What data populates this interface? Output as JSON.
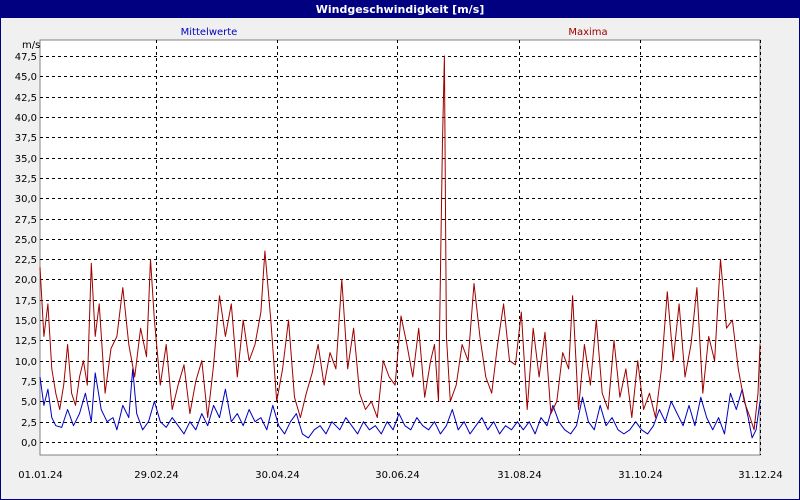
{
  "window": {
    "title": "Windgeschwindigkeit [m/s]"
  },
  "chart_data": {
    "type": "line",
    "title": "Windgeschwindigkeit [m/s]",
    "ylabel": "m/s",
    "xlabel": "",
    "ylim": [
      0,
      47.5
    ],
    "xlim": [
      "2024-01-01",
      "2024-12-31"
    ],
    "y_ticks": [
      "0,0",
      "2,5",
      "5,0",
      "7,5",
      "10,0",
      "12,5",
      "15,0",
      "17,5",
      "20,0",
      "22,5",
      "25,0",
      "27,5",
      "30,0",
      "32,5",
      "35,0",
      "37,5",
      "40,0",
      "42,5",
      "45,0",
      "47,5"
    ],
    "x_ticks": [
      {
        "date": "2024-01-01",
        "label": "01.01.24"
      },
      {
        "date": "2024-02-29",
        "label": "29.02.24"
      },
      {
        "date": "2024-04-30",
        "label": "30.04.24"
      },
      {
        "date": "2024-06-30",
        "label": "30.06.24"
      },
      {
        "date": "2024-08-31",
        "label": "31.08.24"
      },
      {
        "date": "2024-10-31",
        "label": "31.10.24"
      },
      {
        "date": "2024-12-31",
        "label": "31.12.24"
      }
    ],
    "grid": true,
    "series": [
      {
        "name": "Mittelwerte",
        "color": "#0000c0",
        "points": [
          [
            "2024-01-01",
            8.0
          ],
          [
            "2024-01-03",
            4.5
          ],
          [
            "2024-01-05",
            6.5
          ],
          [
            "2024-01-07",
            3.0
          ],
          [
            "2024-01-09",
            2.0
          ],
          [
            "2024-01-12",
            1.8
          ],
          [
            "2024-01-15",
            4.0
          ],
          [
            "2024-01-18",
            2.0
          ],
          [
            "2024-01-21",
            3.5
          ],
          [
            "2024-01-24",
            6.0
          ],
          [
            "2024-01-27",
            2.5
          ],
          [
            "2024-01-29",
            8.5
          ],
          [
            "2024-02-01",
            4.0
          ],
          [
            "2024-02-04",
            2.5
          ],
          [
            "2024-02-07",
            3.0
          ],
          [
            "2024-02-09",
            1.5
          ],
          [
            "2024-02-12",
            4.5
          ],
          [
            "2024-02-15",
            3.0
          ],
          [
            "2024-02-17",
            9.0
          ],
          [
            "2024-02-19",
            3.5
          ],
          [
            "2024-02-22",
            1.5
          ],
          [
            "2024-02-25",
            2.5
          ],
          [
            "2024-02-28",
            5.0
          ],
          [
            "2024-03-02",
            2.5
          ],
          [
            "2024-03-05",
            1.8
          ],
          [
            "2024-03-08",
            3.0
          ],
          [
            "2024-03-11",
            2.0
          ],
          [
            "2024-03-14",
            1.0
          ],
          [
            "2024-03-17",
            2.5
          ],
          [
            "2024-03-20",
            1.5
          ],
          [
            "2024-03-23",
            3.5
          ],
          [
            "2024-03-26",
            2.0
          ],
          [
            "2024-03-29",
            4.5
          ],
          [
            "2024-04-01",
            3.0
          ],
          [
            "2024-04-04",
            6.5
          ],
          [
            "2024-04-07",
            2.5
          ],
          [
            "2024-04-10",
            3.5
          ],
          [
            "2024-04-13",
            2.0
          ],
          [
            "2024-04-16",
            4.0
          ],
          [
            "2024-04-19",
            2.5
          ],
          [
            "2024-04-22",
            3.0
          ],
          [
            "2024-04-25",
            1.5
          ],
          [
            "2024-04-28",
            4.5
          ],
          [
            "2024-05-01",
            2.0
          ],
          [
            "2024-05-04",
            1.0
          ],
          [
            "2024-05-07",
            2.5
          ],
          [
            "2024-05-10",
            3.5
          ],
          [
            "2024-05-13",
            1.0
          ],
          [
            "2024-05-16",
            0.5
          ],
          [
            "2024-05-19",
            1.5
          ],
          [
            "2024-05-22",
            2.0
          ],
          [
            "2024-05-25",
            1.0
          ],
          [
            "2024-05-28",
            2.5
          ],
          [
            "2024-06-01",
            1.5
          ],
          [
            "2024-06-04",
            3.0
          ],
          [
            "2024-06-07",
            2.0
          ],
          [
            "2024-06-10",
            1.0
          ],
          [
            "2024-06-13",
            2.5
          ],
          [
            "2024-06-16",
            1.5
          ],
          [
            "2024-06-19",
            2.0
          ],
          [
            "2024-06-22",
            1.0
          ],
          [
            "2024-06-25",
            2.5
          ],
          [
            "2024-06-28",
            1.5
          ],
          [
            "2024-07-01",
            3.5
          ],
          [
            "2024-07-04",
            2.0
          ],
          [
            "2024-07-07",
            1.5
          ],
          [
            "2024-07-10",
            3.0
          ],
          [
            "2024-07-13",
            2.0
          ],
          [
            "2024-07-16",
            1.5
          ],
          [
            "2024-07-19",
            2.5
          ],
          [
            "2024-07-22",
            1.0
          ],
          [
            "2024-07-25",
            2.0
          ],
          [
            "2024-07-28",
            4.0
          ],
          [
            "2024-07-31",
            1.5
          ],
          [
            "2024-08-03",
            2.5
          ],
          [
            "2024-08-06",
            1.0
          ],
          [
            "2024-08-09",
            2.0
          ],
          [
            "2024-08-12",
            3.0
          ],
          [
            "2024-08-15",
            1.5
          ],
          [
            "2024-08-18",
            2.5
          ],
          [
            "2024-08-21",
            1.0
          ],
          [
            "2024-08-24",
            2.0
          ],
          [
            "2024-08-27",
            1.5
          ],
          [
            "2024-08-30",
            2.5
          ],
          [
            "2024-09-02",
            1.5
          ],
          [
            "2024-09-05",
            2.5
          ],
          [
            "2024-09-08",
            1.0
          ],
          [
            "2024-09-11",
            3.0
          ],
          [
            "2024-09-14",
            2.0
          ],
          [
            "2024-09-17",
            4.5
          ],
          [
            "2024-09-20",
            2.5
          ],
          [
            "2024-09-23",
            1.5
          ],
          [
            "2024-09-26",
            1.0
          ],
          [
            "2024-09-29",
            2.0
          ],
          [
            "2024-10-02",
            5.5
          ],
          [
            "2024-10-05",
            2.5
          ],
          [
            "2024-10-08",
            1.5
          ],
          [
            "2024-10-11",
            4.5
          ],
          [
            "2024-10-14",
            2.0
          ],
          [
            "2024-10-17",
            3.0
          ],
          [
            "2024-10-20",
            1.5
          ],
          [
            "2024-10-23",
            1.0
          ],
          [
            "2024-10-26",
            1.5
          ],
          [
            "2024-10-29",
            2.5
          ],
          [
            "2024-11-01",
            1.5
          ],
          [
            "2024-11-04",
            1.0
          ],
          [
            "2024-11-07",
            2.0
          ],
          [
            "2024-11-10",
            4.0
          ],
          [
            "2024-11-13",
            2.5
          ],
          [
            "2024-11-16",
            5.0
          ],
          [
            "2024-11-19",
            3.5
          ],
          [
            "2024-11-22",
            2.0
          ],
          [
            "2024-11-25",
            4.5
          ],
          [
            "2024-11-28",
            2.0
          ],
          [
            "2024-12-01",
            5.5
          ],
          [
            "2024-12-04",
            3.0
          ],
          [
            "2024-12-07",
            1.5
          ],
          [
            "2024-12-10",
            3.0
          ],
          [
            "2024-12-13",
            1.0
          ],
          [
            "2024-12-16",
            6.0
          ],
          [
            "2024-12-19",
            4.0
          ],
          [
            "2024-12-22",
            6.5
          ],
          [
            "2024-12-25",
            3.0
          ],
          [
            "2024-12-27",
            0.5
          ],
          [
            "2024-12-29",
            1.5
          ],
          [
            "2024-12-31",
            5.0
          ]
        ]
      },
      {
        "name": "Maxima",
        "color": "#a00000",
        "points": [
          [
            "2024-01-01",
            21.5
          ],
          [
            "2024-01-03",
            13.0
          ],
          [
            "2024-01-05",
            17.0
          ],
          [
            "2024-01-07",
            9.0
          ],
          [
            "2024-01-09",
            6.0
          ],
          [
            "2024-01-11",
            4.0
          ],
          [
            "2024-01-13",
            7.0
          ],
          [
            "2024-01-15",
            12.0
          ],
          [
            "2024-01-17",
            6.0
          ],
          [
            "2024-01-19",
            4.5
          ],
          [
            "2024-01-21",
            8.0
          ],
          [
            "2024-01-23",
            10.0
          ],
          [
            "2024-01-25",
            7.0
          ],
          [
            "2024-01-27",
            22.0
          ],
          [
            "2024-01-29",
            13.0
          ],
          [
            "2024-01-31",
            17.0
          ],
          [
            "2024-02-03",
            6.0
          ],
          [
            "2024-02-06",
            11.5
          ],
          [
            "2024-02-09",
            13.0
          ],
          [
            "2024-02-12",
            19.0
          ],
          [
            "2024-02-15",
            12.0
          ],
          [
            "2024-02-18",
            8.0
          ],
          [
            "2024-02-21",
            14.0
          ],
          [
            "2024-02-24",
            10.5
          ],
          [
            "2024-02-26",
            22.5
          ],
          [
            "2024-02-28",
            15.0
          ],
          [
            "2024-03-02",
            7.0
          ],
          [
            "2024-03-05",
            12.0
          ],
          [
            "2024-03-08",
            4.0
          ],
          [
            "2024-03-11",
            7.0
          ],
          [
            "2024-03-14",
            9.5
          ],
          [
            "2024-03-17",
            3.5
          ],
          [
            "2024-03-20",
            7.5
          ],
          [
            "2024-03-23",
            10.0
          ],
          [
            "2024-03-26",
            3.0
          ],
          [
            "2024-03-29",
            9.5
          ],
          [
            "2024-04-01",
            18.0
          ],
          [
            "2024-04-04",
            13.0
          ],
          [
            "2024-04-07",
            17.0
          ],
          [
            "2024-04-10",
            8.0
          ],
          [
            "2024-04-13",
            15.0
          ],
          [
            "2024-04-16",
            10.0
          ],
          [
            "2024-04-19",
            12.0
          ],
          [
            "2024-04-22",
            16.0
          ],
          [
            "2024-04-24",
            23.5
          ],
          [
            "2024-04-27",
            15.0
          ],
          [
            "2024-04-30",
            5.0
          ],
          [
            "2024-05-03",
            9.0
          ],
          [
            "2024-05-06",
            15.0
          ],
          [
            "2024-05-09",
            5.5
          ],
          [
            "2024-05-12",
            3.0
          ],
          [
            "2024-05-15",
            6.0
          ],
          [
            "2024-05-18",
            8.5
          ],
          [
            "2024-05-21",
            12.0
          ],
          [
            "2024-05-24",
            7.0
          ],
          [
            "2024-05-27",
            11.0
          ],
          [
            "2024-05-30",
            9.0
          ],
          [
            "2024-06-02",
            20.0
          ],
          [
            "2024-06-05",
            9.0
          ],
          [
            "2024-06-08",
            14.0
          ],
          [
            "2024-06-11",
            6.0
          ],
          [
            "2024-06-14",
            4.0
          ],
          [
            "2024-06-17",
            5.0
          ],
          [
            "2024-06-20",
            3.0
          ],
          [
            "2024-06-23",
            10.0
          ],
          [
            "2024-06-26",
            8.0
          ],
          [
            "2024-06-29",
            7.0
          ],
          [
            "2024-07-02",
            15.5
          ],
          [
            "2024-07-05",
            12.0
          ],
          [
            "2024-07-08",
            8.0
          ],
          [
            "2024-07-11",
            14.0
          ],
          [
            "2024-07-14",
            5.5
          ],
          [
            "2024-07-17",
            10.0
          ],
          [
            "2024-07-19",
            12.0
          ],
          [
            "2024-07-21",
            5.0
          ],
          [
            "2024-07-23",
            36.5
          ],
          [
            "2024-07-24",
            47.5
          ],
          [
            "2024-07-25",
            13.0
          ],
          [
            "2024-07-27",
            5.0
          ],
          [
            "2024-07-30",
            7.0
          ],
          [
            "2024-08-02",
            12.0
          ],
          [
            "2024-08-05",
            10.0
          ],
          [
            "2024-08-08",
            19.5
          ],
          [
            "2024-08-11",
            13.0
          ],
          [
            "2024-08-14",
            8.0
          ],
          [
            "2024-08-17",
            6.0
          ],
          [
            "2024-08-20",
            12.0
          ],
          [
            "2024-08-23",
            17.0
          ],
          [
            "2024-08-26",
            10.0
          ],
          [
            "2024-08-29",
            9.5
          ],
          [
            "2024-09-01",
            16.0
          ],
          [
            "2024-09-04",
            4.0
          ],
          [
            "2024-09-07",
            14.0
          ],
          [
            "2024-09-10",
            8.0
          ],
          [
            "2024-09-13",
            13.5
          ],
          [
            "2024-09-16",
            3.5
          ],
          [
            "2024-09-19",
            5.0
          ],
          [
            "2024-09-22",
            11.0
          ],
          [
            "2024-09-25",
            9.0
          ],
          [
            "2024-09-27",
            18.0
          ],
          [
            "2024-09-30",
            4.0
          ],
          [
            "2024-10-03",
            12.0
          ],
          [
            "2024-10-06",
            7.0
          ],
          [
            "2024-10-09",
            15.0
          ],
          [
            "2024-10-12",
            6.0
          ],
          [
            "2024-10-15",
            4.0
          ],
          [
            "2024-10-18",
            12.5
          ],
          [
            "2024-10-21",
            5.5
          ],
          [
            "2024-10-24",
            9.0
          ],
          [
            "2024-10-27",
            3.0
          ],
          [
            "2024-10-30",
            10.0
          ],
          [
            "2024-11-02",
            4.0
          ],
          [
            "2024-11-05",
            6.0
          ],
          [
            "2024-11-08",
            3.0
          ],
          [
            "2024-11-11",
            9.0
          ],
          [
            "2024-11-14",
            18.5
          ],
          [
            "2024-11-17",
            10.0
          ],
          [
            "2024-11-20",
            17.0
          ],
          [
            "2024-11-23",
            8.0
          ],
          [
            "2024-11-26",
            12.0
          ],
          [
            "2024-11-29",
            19.0
          ],
          [
            "2024-12-02",
            6.0
          ],
          [
            "2024-12-05",
            13.0
          ],
          [
            "2024-12-08",
            10.0
          ],
          [
            "2024-12-11",
            22.5
          ],
          [
            "2024-12-14",
            14.0
          ],
          [
            "2024-12-17",
            15.0
          ],
          [
            "2024-12-20",
            9.0
          ],
          [
            "2024-12-23",
            5.0
          ],
          [
            "2024-12-26",
            3.0
          ],
          [
            "2024-12-28",
            1.5
          ],
          [
            "2024-12-30",
            6.0
          ],
          [
            "2024-12-31",
            12.0
          ]
        ]
      }
    ]
  }
}
